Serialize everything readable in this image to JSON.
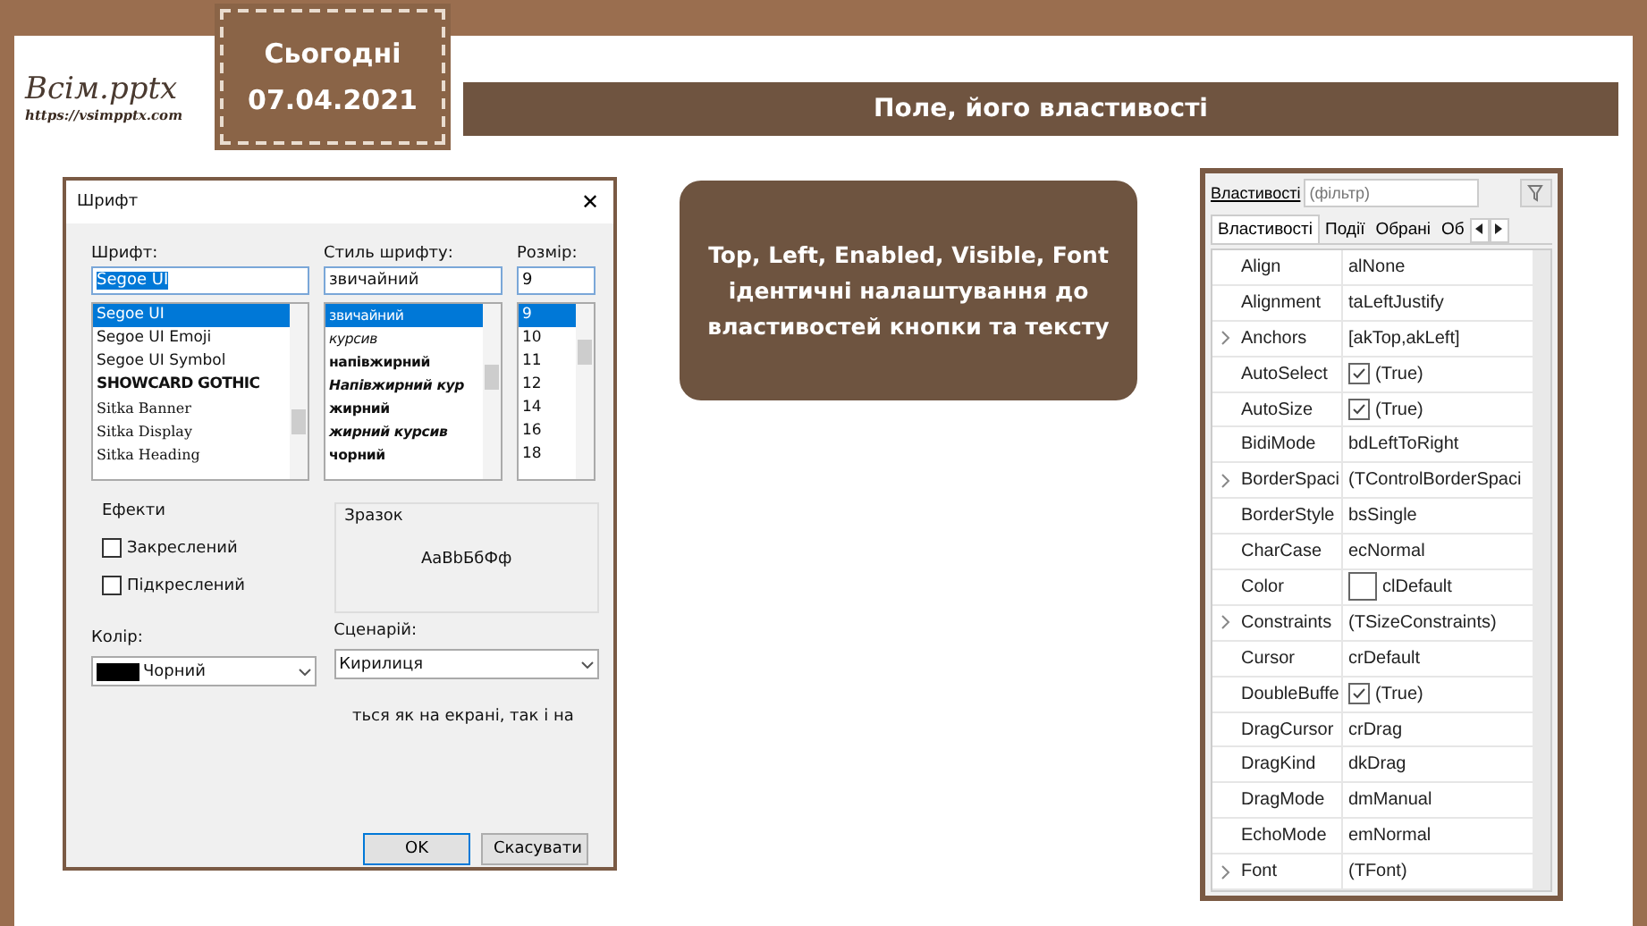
{
  "header": {
    "logo": "Всім.pptx",
    "logo_url": "https://vsimpptx.com",
    "date_label": "Сьогодні",
    "date": "07.04.2021",
    "title": "Поле, його властивості"
  },
  "font_dialog": {
    "title": "Шрифт",
    "close": "✕",
    "font_label": "Шрифт:",
    "font_value": "Segoe UI",
    "fonts": [
      {
        "name": "Segoe UI",
        "kind": "plain",
        "selected": true
      },
      {
        "name": "Segoe UI Emoji",
        "kind": "plain",
        "selected": false
      },
      {
        "name": "Segoe UI Symbol",
        "kind": "plain",
        "selected": false
      },
      {
        "name": "SHOWCARD GOTHIC",
        "kind": "display",
        "selected": false
      },
      {
        "name": "Sitka Banner",
        "kind": "serif",
        "selected": false
      },
      {
        "name": "Sitka Display",
        "kind": "serif",
        "selected": false
      },
      {
        "name": "Sitka Heading",
        "kind": "serif",
        "selected": false
      }
    ],
    "style_label": "Стиль шрифту:",
    "style_value": "звичайний",
    "styles": [
      {
        "name": "звичайний",
        "kind": "regular",
        "selected": true
      },
      {
        "name": "курсив",
        "kind": "italic",
        "selected": false
      },
      {
        "name": "напівжирний",
        "kind": "semibold",
        "selected": false
      },
      {
        "name": "Напівжирний кур",
        "kind": "semibold-italic",
        "selected": false
      },
      {
        "name": "жирний",
        "kind": "bold",
        "selected": false
      },
      {
        "name": "жирний курсив",
        "kind": "bold-italic",
        "selected": false
      },
      {
        "name": "чорний",
        "kind": "black",
        "selected": false
      }
    ],
    "size_label": "Розмір:",
    "size_value": "9",
    "sizes": [
      {
        "name": "9",
        "selected": true
      },
      {
        "name": "10",
        "selected": false
      },
      {
        "name": "11",
        "selected": false
      },
      {
        "name": "12",
        "selected": false
      },
      {
        "name": "14",
        "selected": false
      },
      {
        "name": "16",
        "selected": false
      },
      {
        "name": "18",
        "selected": false
      }
    ],
    "effects_label": "Ефекти",
    "effects": [
      {
        "label": "Закреслений",
        "checked": false
      },
      {
        "label": "Підкреслений",
        "checked": false
      }
    ],
    "sample_label": "Зразок",
    "sample_text": "АаBbБбФф",
    "color_label": "Колір:",
    "color_value": "Чорний",
    "script_label": "Сценарій:",
    "script_value": "Кирилиця",
    "note": "ться як на екрані, так і на",
    "buttons": [
      "OK",
      "Скасувати"
    ]
  },
  "callout": {
    "heading": "Top, Left, Enabled, Visible, Font",
    "body": "ідентичні налаштування до властивостей кнопки та тексту"
  },
  "properties": {
    "filter_label": "Властивості",
    "filter_placeholder": "(фільтр)",
    "tabs": [
      {
        "label": "Властивості",
        "selected": true
      },
      {
        "label": "Події",
        "selected": false
      },
      {
        "label": "Обрані",
        "selected": false
      },
      {
        "label": "Об",
        "selected": false
      }
    ],
    "rows": [
      {
        "name": "Align",
        "value": "alNone",
        "kind": "text",
        "expandable": false
      },
      {
        "name": "Alignment",
        "value": "taLeftJustify",
        "kind": "text",
        "expandable": false
      },
      {
        "name": "Anchors",
        "value": "[akTop,akLeft]",
        "kind": "text",
        "expandable": true
      },
      {
        "name": "AutoSelect",
        "value": "(True)",
        "kind": "check",
        "checked": true,
        "expandable": false
      },
      {
        "name": "AutoSize",
        "value": "(True)",
        "kind": "check",
        "checked": true,
        "expandable": false
      },
      {
        "name": "BidiMode",
        "value": "bdLeftToRight",
        "kind": "text",
        "expandable": false
      },
      {
        "name": "BorderSpaci",
        "value": "(TControlBorderSpaci",
        "kind": "text",
        "expandable": true
      },
      {
        "name": "BorderStyle",
        "value": "bsSingle",
        "kind": "text",
        "expandable": false
      },
      {
        "name": "CharCase",
        "value": "ecNormal",
        "kind": "text",
        "expandable": false
      },
      {
        "name": "Color",
        "value": "clDefault",
        "kind": "swatch",
        "expandable": false
      },
      {
        "name": "Constraints",
        "value": "(TSizeConstraints)",
        "kind": "text",
        "expandable": true
      },
      {
        "name": "Cursor",
        "value": "crDefault",
        "kind": "text",
        "expandable": false
      },
      {
        "name": "DoubleBuffe",
        "value": "(True)",
        "kind": "check",
        "checked": true,
        "expandable": false
      },
      {
        "name": "DragCursor",
        "value": "crDrag",
        "kind": "text",
        "expandable": false
      },
      {
        "name": "DragKind",
        "value": "dkDrag",
        "kind": "text",
        "expandable": false
      },
      {
        "name": "DragMode",
        "value": "dmManual",
        "kind": "text",
        "expandable": false
      },
      {
        "name": "EchoMode",
        "value": "emNormal",
        "kind": "text",
        "expandable": false
      },
      {
        "name": "Font",
        "value": "(TFont)",
        "kind": "text",
        "expandable": true
      }
    ]
  }
}
